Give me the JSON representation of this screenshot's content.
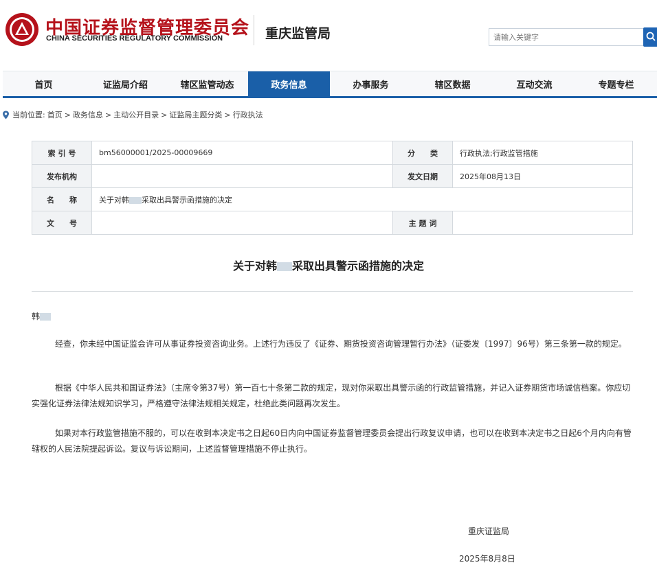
{
  "header": {
    "logo_cn": "中国证券监督管理委员会",
    "logo_en": "CHINA SECURITIES REGULATORY COMMISSION",
    "bureau": "重庆监管局",
    "search_placeholder": "请输入关键字",
    "brand_color": "#b5121b",
    "accent_color": "#1a5fa8"
  },
  "nav": {
    "items": [
      "首页",
      "证监局介绍",
      "辖区监管动态",
      "政务信息",
      "办事服务",
      "辖区数据",
      "互动交流",
      "专题专栏"
    ],
    "active": "政务信息"
  },
  "breadcrumb": {
    "prefix": "当前位置:",
    "items": [
      "首页",
      "政务信息",
      "主动公开目录",
      "证监局主题分类",
      "行政执法"
    ],
    "separator": ">"
  },
  "info": {
    "index_label": "索 引 号",
    "index_value": "bm56000001/2025-00009669",
    "category_label": "分　　类",
    "category_value": "行政执法;行政监管措施",
    "publisher_label": "发布机构",
    "publisher_value": "",
    "date_label": "发文日期",
    "date_value": "2025年08月13日",
    "name_label": "名　　称",
    "name_value_pre": "关于对韩",
    "name_value_post": "采取出具警示函措施的决定",
    "docno_label": "文　　号",
    "docno_value": "",
    "keywords_label": "主 题 词",
    "keywords_value": ""
  },
  "document": {
    "title_pre": "关于对韩",
    "title_post": "采取出具警示函措施的决定",
    "addressee": "韩",
    "paragraphs": [
      "经查，你未经中国证监会许可从事证券投资咨询业务。上述行为违反了《证券、期货投资咨询管理暂行办法》（证委发〔1997〕96号）第三条第一款的规定。",
      "根据《中华人民共和国证券法》（主席令第37号）第一百七十条第二款的规定，现对你采取出具警示函的行政监管措施，并记入证券期货市场诚信档案。你应切实强化证券法律法规知识学习，严格遵守法律法规相关规定，杜绝此类问题再次发生。",
      "如果对本行政监管措施不服的，可以在收到本决定书之日起60日内向中国证券监督管理委员会提出行政复议申请，也可以在收到本决定书之日起6个月内向有管辖权的人民法院提起诉讼。复议与诉讼期间，上述监督管理措施不停止执行。"
    ],
    "signature_org": "重庆证监局",
    "signature_date": "2025年8月8日"
  }
}
